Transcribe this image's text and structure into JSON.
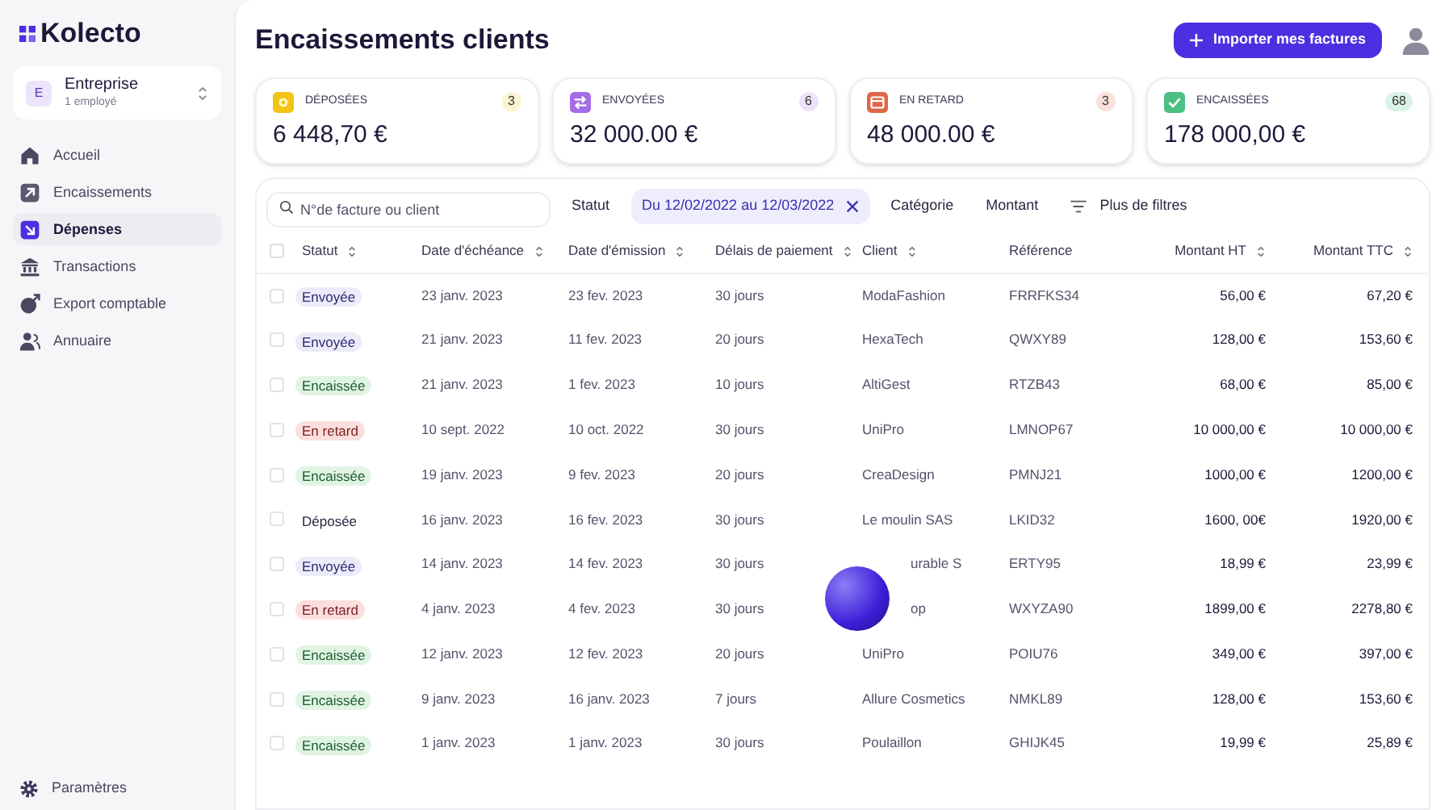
{
  "sidebar": {
    "logo": "Kolecto",
    "company": {
      "initial": "E",
      "name": "Entreprise",
      "subtitle": "1 employé"
    },
    "items": [
      {
        "label": "Accueil",
        "selected": false
      },
      {
        "label": "Encaissements",
        "selected": false
      },
      {
        "label": "Dépenses",
        "selected": true
      },
      {
        "label": "Transactions",
        "selected": false
      },
      {
        "label": "Export comptable",
        "selected": false
      },
      {
        "label": "Annuaire",
        "selected": false
      }
    ],
    "footer_item": {
      "label": "Paramètres"
    }
  },
  "header": {
    "title": "Encaissements clients",
    "import_button": "Importer mes factures"
  },
  "stats": [
    {
      "label": "DÉPOSÉES",
      "count": "3",
      "amount": "6 448,70 €",
      "color": "#f2c515"
    },
    {
      "label": "ENVOYÉES",
      "count": "6",
      "amount": "32 000.00 €",
      "color": "#a56ce8"
    },
    {
      "label": "EN RETARD",
      "count": "3",
      "amount": "48 000.00 €",
      "color": "#e0664a"
    },
    {
      "label": "ENCAISSÉES",
      "count": "68",
      "amount": "178 000,00 €",
      "color": "#4cc083"
    }
  ],
  "filters": {
    "search_placeholder": "N°de facture ou client",
    "chips": [
      {
        "label": "Statut",
        "active": false
      },
      {
        "label": "Du 12/02/2022 au 12/03/2022",
        "active": true
      },
      {
        "label": "Catégorie",
        "active": false
      },
      {
        "label": "Montant",
        "active": false
      }
    ],
    "more": "Plus de filtres"
  },
  "table": {
    "select_all_checked": false,
    "columns": [
      {
        "label": "Statut",
        "sortable": true
      },
      {
        "label": "Date d'échéance",
        "sortable": true
      },
      {
        "label": "Date d'émission",
        "sortable": true
      },
      {
        "label": "Délais de paiement",
        "sortable": true
      },
      {
        "label": "Client",
        "sortable": true
      },
      {
        "label": "Référence",
        "sortable": false
      },
      {
        "label": "Montant HT",
        "sortable": true
      },
      {
        "label": "Montant TTC",
        "sortable": true
      }
    ],
    "rows": [
      {
        "kind": "sent",
        "checked": false,
        "cells": [
          "Envoyée",
          "23 janv. 2023",
          "23 fev. 2023",
          "30 jours",
          "ModaFashion",
          "FRRFKS34",
          "56,00 €",
          "67,20 €"
        ]
      },
      {
        "kind": "sent",
        "checked": false,
        "cells": [
          "Envoyée",
          "21 janv. 2023",
          "11 fev. 2023",
          "20 jours",
          "HexaTech",
          "QWXY89",
          "128,00 €",
          "153,60 €"
        ]
      },
      {
        "kind": "paid",
        "checked": false,
        "cells": [
          "Encaissée",
          "21 janv. 2023",
          "1 fev. 2023",
          "10 jours",
          "AltiGest",
          "RTZB43",
          "68,00 €",
          "85,00 €"
        ]
      },
      {
        "kind": "late",
        "checked": false,
        "cells": [
          "En retard",
          "10 sept. 2022",
          "10 oct. 2022",
          "30 jours",
          "UniPro",
          "LMNOP67",
          "10 000,00 €",
          "10 000,00 €"
        ]
      },
      {
        "kind": "paid",
        "checked": false,
        "cells": [
          "Encaissée",
          "19 janv. 2023",
          "9 fev. 2023",
          "20 jours",
          "CreaDesign",
          "PMNJ21",
          "1000,00 €",
          "1200,00 €"
        ]
      },
      {
        "kind": "filed",
        "checked": false,
        "cells": [
          "Déposée",
          "16 janv. 2023",
          "16 fev. 2023",
          "30 jours",
          "Le moulin SAS",
          "LKID32",
          "1600, 00€",
          "1920,00 €"
        ]
      },
      {
        "kind": "sent",
        "checked": false,
        "cells": [
          "Envoyée",
          "14 janv. 2023",
          "14 fev. 2023",
          "30 jours",
          "urable S",
          "ERTY95",
          "18,99 €",
          "23,99 €"
        ]
      },
      {
        "kind": "late",
        "checked": false,
        "cells": [
          "En retard",
          "4 janv. 2023",
          "4 fev. 2023",
          "30 jours",
          "op",
          "WXYZA90",
          "1899,00 €",
          "2278,80 €"
        ]
      },
      {
        "kind": "paid",
        "checked": false,
        "cells": [
          "Encaissée",
          "12 janv. 2023",
          "12 fev. 2023",
          "20 jours",
          "UniPro",
          "POIU76",
          "349,00 €",
          "397,00 €"
        ]
      },
      {
        "kind": "paid",
        "checked": false,
        "cells": [
          "Encaissée",
          "9 janv. 2023",
          "16 janv. 2023",
          "7 jours",
          "Allure Cosmetics",
          "NMKL89",
          "128,00 €",
          "153,60 €"
        ]
      },
      {
        "kind": "paid",
        "checked": false,
        "cells": [
          "Encaissée",
          "1 janv. 2023",
          "1 janv. 2023",
          "30 jours",
          "Poulaillon",
          "GHIJK45",
          "19,99 €",
          "25,89 €"
        ]
      }
    ]
  }
}
